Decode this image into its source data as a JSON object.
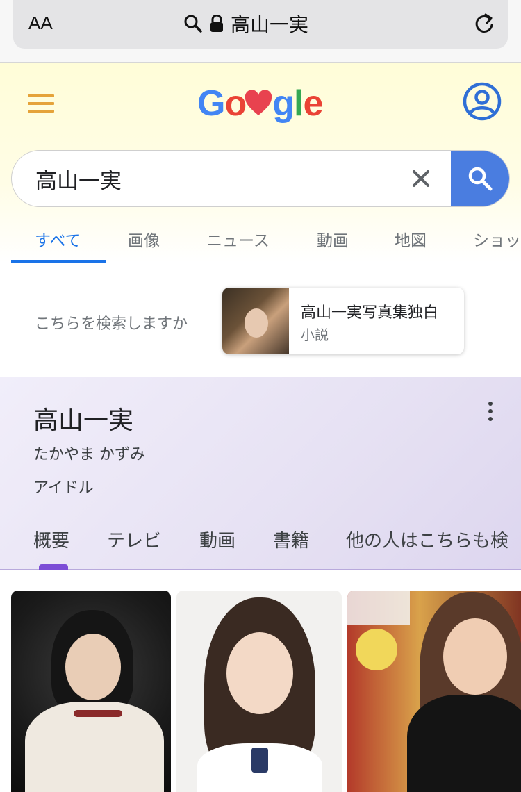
{
  "browser": {
    "aa_label": "AA",
    "url_text": "高山一実"
  },
  "google": {
    "logo_text": "Google",
    "search_value": "高山一実",
    "tabs": [
      "すべて",
      "画像",
      "ニュース",
      "動画",
      "地図",
      "ショッ"
    ],
    "active_tab": "すべて",
    "colors": {
      "accent": "#1a73e8",
      "search_button": "#4a7de0",
      "hamburger": "#e5a33a"
    }
  },
  "suggest": {
    "label": "こちらを検索しますか",
    "title": "高山一実写真集独白",
    "subtitle": "小説"
  },
  "knowledge_panel": {
    "title": "高山一実",
    "reading": "たかやま かずみ",
    "type": "アイドル",
    "tabs": [
      "概要",
      "テレビ",
      "動画",
      "書籍",
      "他の人はこちらも検"
    ],
    "active_tab": "概要",
    "accent": "#7c4dd6"
  }
}
